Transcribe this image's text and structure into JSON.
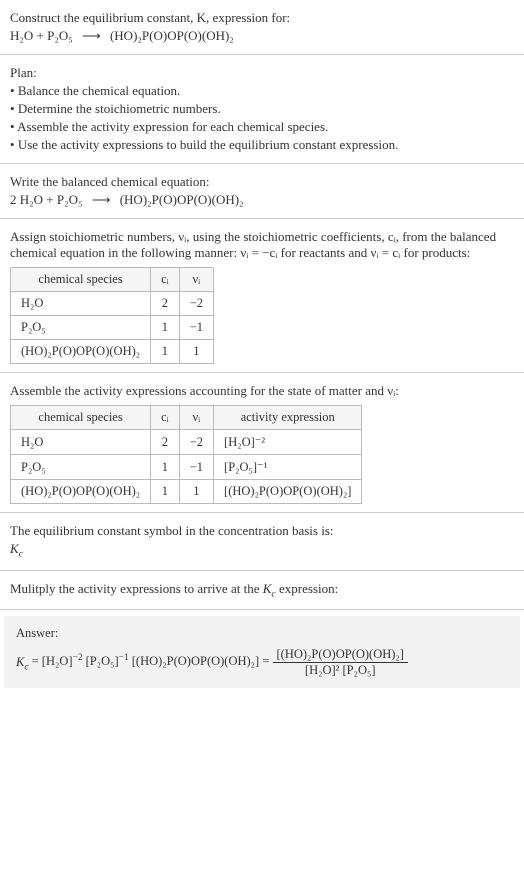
{
  "intro": {
    "line1": "Construct the equilibrium constant, K, expression for:",
    "equation_lhs": "H₂O + P₂O₅",
    "equation_rhs": "(HO)₂P(O)OP(O)(OH)₂"
  },
  "plan": {
    "heading": "Plan:",
    "items": [
      "Balance the chemical equation.",
      "Determine the stoichiometric numbers.",
      "Assemble the activity expression for each chemical species.",
      "Use the activity expressions to build the equilibrium constant expression."
    ]
  },
  "balanced": {
    "heading": "Write the balanced chemical equation:",
    "lhs": "2 H₂O + P₂O₅",
    "rhs": "(HO)₂P(O)OP(O)(OH)₂"
  },
  "assign": {
    "text": "Assign stoichiometric numbers, νᵢ, using the stoichiometric coefficients, cᵢ, from the balanced chemical equation in the following manner: νᵢ = −cᵢ for reactants and νᵢ = cᵢ for products:",
    "headers": [
      "chemical species",
      "cᵢ",
      "νᵢ"
    ],
    "rows": [
      {
        "species": "H₂O",
        "c": "2",
        "v": "−2"
      },
      {
        "species": "P₂O₅",
        "c": "1",
        "v": "−1"
      },
      {
        "species": "(HO)₂P(O)OP(O)(OH)₂",
        "c": "1",
        "v": "1"
      }
    ]
  },
  "activity": {
    "heading": "Assemble the activity expressions accounting for the state of matter and νᵢ:",
    "headers": [
      "chemical species",
      "cᵢ",
      "νᵢ",
      "activity expression"
    ],
    "rows": [
      {
        "species": "H₂O",
        "c": "2",
        "v": "−2",
        "act": "[H₂O]⁻²"
      },
      {
        "species": "P₂O₅",
        "c": "1",
        "v": "−1",
        "act": "[P₂O₅]⁻¹"
      },
      {
        "species": "(HO)₂P(O)OP(O)(OH)₂",
        "c": "1",
        "v": "1",
        "act": "[(HO)₂P(O)OP(O)(OH)₂]"
      }
    ]
  },
  "symbol": {
    "line1": "The equilibrium constant symbol in the concentration basis is:",
    "line2": "K_c"
  },
  "multiply": {
    "text": "Mulitply the activity expressions to arrive at the K_c expression:"
  },
  "answer": {
    "label": "Answer:",
    "lhs": "K_c = [H₂O]⁻² [P₂O₅]⁻¹ [(HO)₂P(O)OP(O)(OH)₂] =",
    "frac_num": "[(HO)₂P(O)OP(O)(OH)₂]",
    "frac_den": "[H₂O]² [P₂O₅]"
  },
  "chart_data": {
    "type": "table",
    "title": "Stoichiometric numbers and activity expressions",
    "tables": [
      {
        "columns": [
          "chemical species",
          "c_i",
          "ν_i"
        ],
        "rows": [
          [
            "H2O",
            2,
            -2
          ],
          [
            "P2O5",
            1,
            -1
          ],
          [
            "(HO)2P(O)OP(O)(OH)2",
            1,
            1
          ]
        ]
      },
      {
        "columns": [
          "chemical species",
          "c_i",
          "ν_i",
          "activity expression"
        ],
        "rows": [
          [
            "H2O",
            2,
            -2,
            "[H2O]^-2"
          ],
          [
            "P2O5",
            1,
            -1,
            "[P2O5]^-1"
          ],
          [
            "(HO)2P(O)OP(O)(OH)2",
            1,
            1,
            "[(HO)2P(O)OP(O)(OH)2]"
          ]
        ]
      }
    ]
  }
}
